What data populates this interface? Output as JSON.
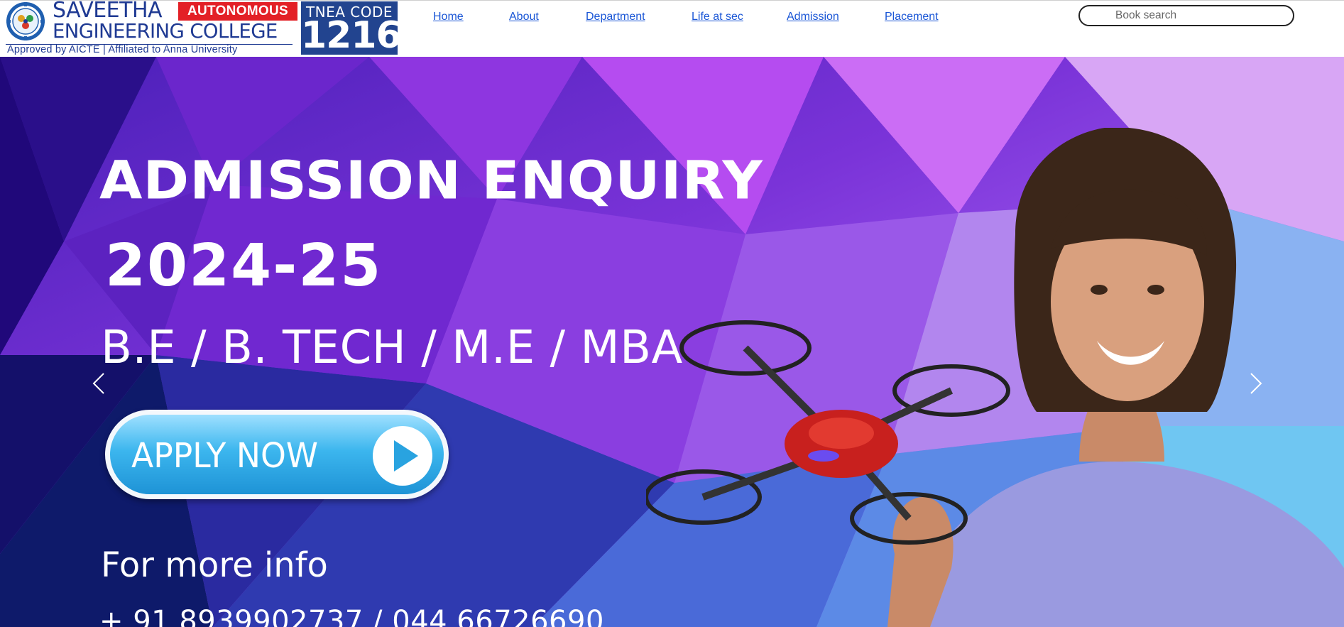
{
  "header": {
    "logo": {
      "name": "SAVEETHA",
      "badge": "AUTONOMOUS",
      "college": "ENGINEERING COLLEGE",
      "subtitle": "Approved by AICTE  |  Affiliated to Anna University",
      "tnea_label": "TNEA CODE",
      "tnea_code": "1216"
    },
    "nav": [
      {
        "label": "Home"
      },
      {
        "label": "About"
      },
      {
        "label": "Department"
      },
      {
        "label": "Life at sec"
      },
      {
        "label": "Admission"
      },
      {
        "label": "Placement"
      }
    ],
    "search": {
      "placeholder": "Book search",
      "value": ""
    }
  },
  "hero": {
    "title": "ADMISSION ENQUIRY",
    "year": "2024-25",
    "programs": "B.E / B. TECH / M.E / MBA",
    "apply_label": "APPLY NOW",
    "more_info": "For more info",
    "phone": "+ 91 8939902737 / 044 66726690"
  },
  "colors": {
    "brand_blue": "#1f3a93",
    "badge_red": "#e32026",
    "tnea_bg": "#22448f",
    "link": "#1a56d6",
    "hero_purple": "#6c3fd8"
  }
}
